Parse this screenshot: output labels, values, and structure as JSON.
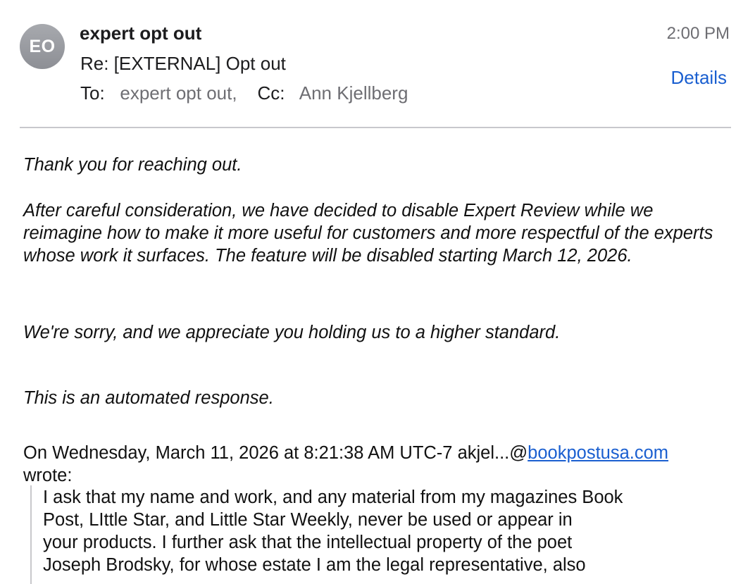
{
  "header": {
    "avatar_initials": "EO",
    "sender": "expert opt out",
    "subject": "Re: [EXTERNAL] Opt out",
    "to_label": "To:",
    "to_value": "expert opt out,",
    "cc_label": "Cc:",
    "cc_value": "Ann Kjellberg",
    "time": "2:00 PM",
    "details_label": "Details"
  },
  "body": {
    "p1": "Thank you for reaching out.",
    "p2": "After careful consideration, we have decided to disable Expert Review while we reimagine how to make it more useful for customers and more respectful of the experts whose work it surfaces. The feature will be disabled starting March 12, 2026.",
    "p3": "We're sorry, and we appreciate you holding us to a higher standard.",
    "p4": "This is an automated response."
  },
  "quote": {
    "intro": "On Wednesday, March 11, 2026 at 8:21:38 AM UTC-7 akjel...@",
    "link": "bookpostusa.com",
    "wrote": "wrote:",
    "lines": [
      "I ask that my name and work, and any material from my magazines Book",
      "Post, LIttle Star, and Little Star Weekly, never be used or appear in",
      "your products. I further ask that the intellectual property of the poet",
      "Joseph Brodsky, for whose estate I am the legal representative, also"
    ]
  },
  "colors": {
    "link": "#1a5fd0",
    "avatar": "#9a9ca1",
    "secondary_text": "#6e6e73"
  }
}
